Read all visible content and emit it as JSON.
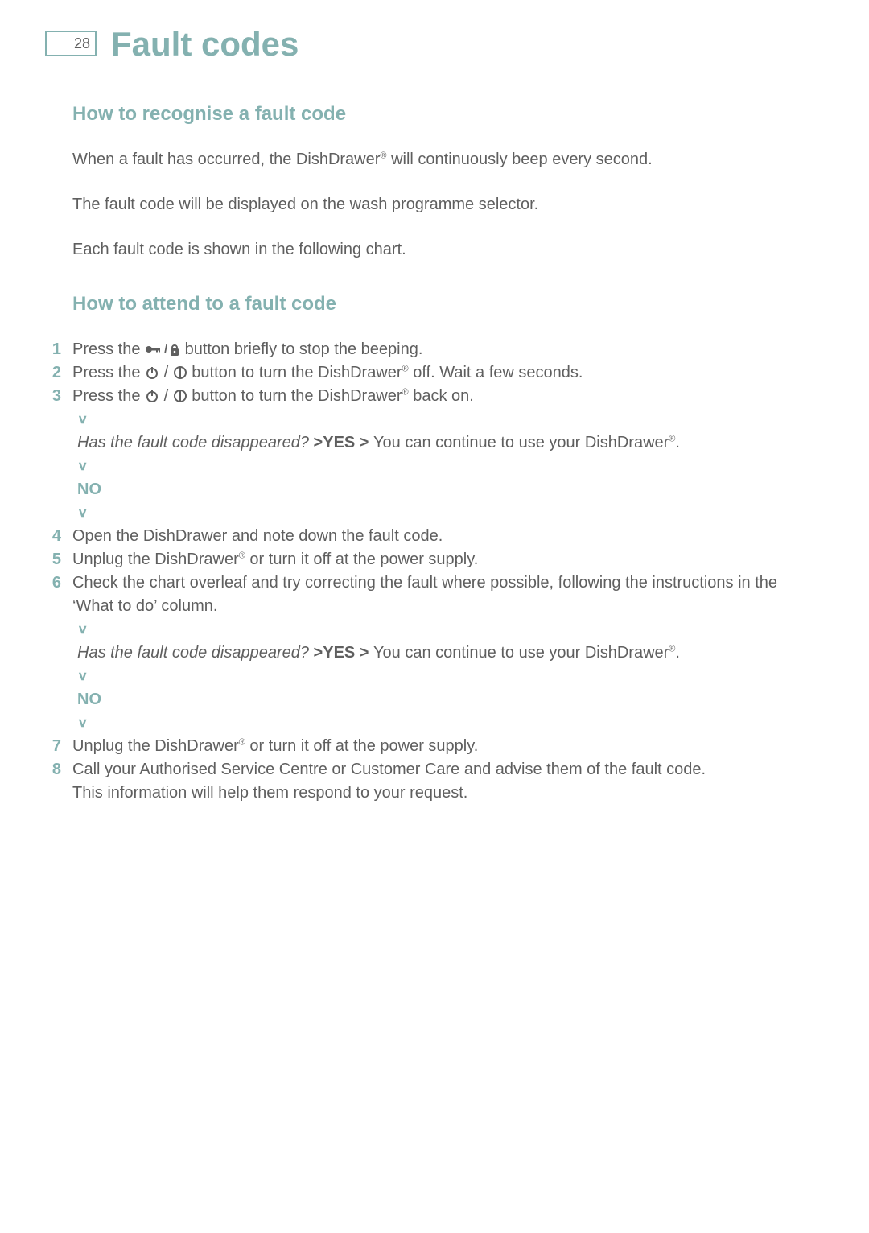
{
  "header": {
    "page_number": "28",
    "title": "Fault codes"
  },
  "section1": {
    "heading": "How to recognise a fault code",
    "p1_a": "When a fault has occurred, the DishDrawer",
    "p1_b": " will continuously beep every second.",
    "p2": "The fault code will be displayed on the wash programme selector.",
    "p3": "Each fault code is shown in the following chart."
  },
  "section2": {
    "heading": "How to attend to a fault code"
  },
  "steps": {
    "s1_num": "1",
    "s1_a": "Press the ",
    "s1_b": " button briefly to stop the beeping.",
    "s2_num": "2",
    "s2_a": "Press the  ",
    "s2_b": " button to turn the DishDrawer",
    "s2_c": " off. Wait a few seconds.",
    "s3_num": "3",
    "s3_a": "Press the  ",
    "s3_b": " button to turn the DishDrawer",
    "s3_c": " back on.",
    "s4_num": "4",
    "s4": "Open the DishDrawer and note down the fault code.",
    "s5_num": "5",
    "s5_a": "Unplug the DishDrawer",
    "s5_b": " or turn it off at the power supply.",
    "s6_num": "6",
    "s6": "Check the chart overleaf and try correcting the fault where possible, following the instructions in the ‘What to do’ column.",
    "s7_num": "7",
    "s7_a": "Unplug the DishDrawer",
    "s7_b": " or turn it off at the power supply.",
    "s8_num": "8",
    "s8_line1": "Call your Authorised Service Centre or Customer Care and advise them of the fault code.",
    "s8_line2": "This information will help them respond to your request."
  },
  "flow1": {
    "question": "Has the fault code disappeared? ",
    "yes": ">YES > ",
    "after_a": "You can continue to use your DishDrawer",
    "after_b": ".",
    "no": "NO"
  },
  "flow2": {
    "question": "Has the fault code disappeared? ",
    "yes": ">YES > ",
    "after_a": "You can continue to use your DishDrawer",
    "after_b": ".",
    "no": "NO"
  },
  "glyphs": {
    "reg": "®",
    "slash": " / ",
    "down_caret": "∨"
  }
}
